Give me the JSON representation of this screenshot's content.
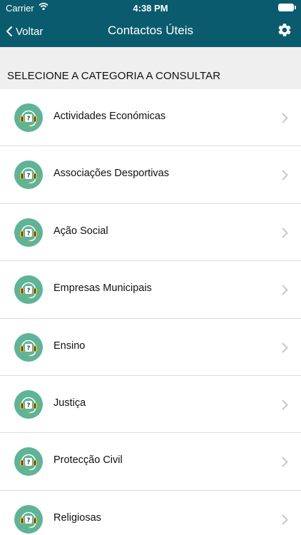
{
  "status_bar": {
    "carrier": "Carrier",
    "time": "4:38 PM"
  },
  "nav": {
    "back_label": "Voltar",
    "title": "Contactos Úteis"
  },
  "section": {
    "title": "SELECIONE A CATEGORIA A CONSULTAR"
  },
  "categories": [
    {
      "label": "Actividades Económicas",
      "icon": "headset-help-icon"
    },
    {
      "label": "Associações Desportivas",
      "icon": "headset-help-icon"
    },
    {
      "label": "Ação Social",
      "icon": "headset-help-icon"
    },
    {
      "label": "Empresas Municipais",
      "icon": "headset-help-icon"
    },
    {
      "label": "Ensino",
      "icon": "headset-help-icon"
    },
    {
      "label": "Justiça",
      "icon": "headset-help-icon"
    },
    {
      "label": "Protecção Civil",
      "icon": "headset-help-icon"
    },
    {
      "label": "Religiosas",
      "icon": "headset-help-icon"
    }
  ],
  "colors": {
    "header": "#0a5b6e",
    "icon_background": "#5fb396",
    "icon_accent": "#f0b323",
    "chevron": "#c7c7cc"
  }
}
